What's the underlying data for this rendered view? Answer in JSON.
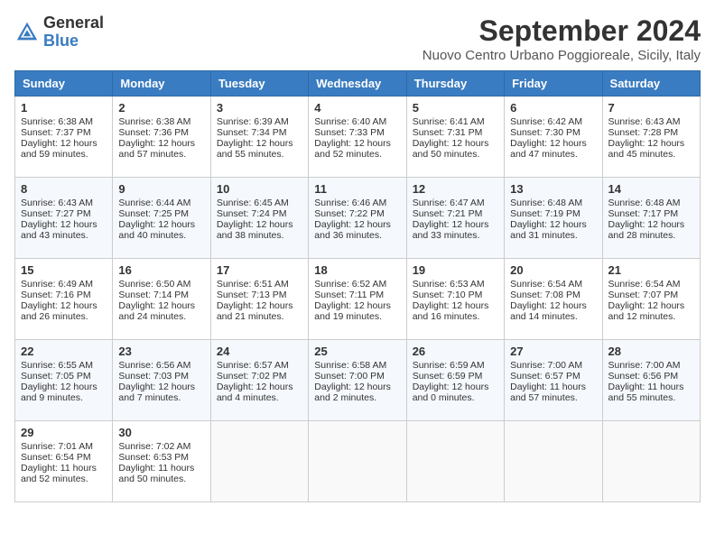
{
  "header": {
    "logo_general": "General",
    "logo_blue": "Blue",
    "title": "September 2024",
    "subtitle": "Nuovo Centro Urbano Poggioreale, Sicily, Italy"
  },
  "columns": [
    "Sunday",
    "Monday",
    "Tuesday",
    "Wednesday",
    "Thursday",
    "Friday",
    "Saturday"
  ],
  "weeks": [
    [
      {
        "day": "1",
        "sunrise": "6:38 AM",
        "sunset": "7:37 PM",
        "daylight": "12 hours and 59 minutes."
      },
      {
        "day": "2",
        "sunrise": "6:38 AM",
        "sunset": "7:36 PM",
        "daylight": "12 hours and 57 minutes."
      },
      {
        "day": "3",
        "sunrise": "6:39 AM",
        "sunset": "7:34 PM",
        "daylight": "12 hours and 55 minutes."
      },
      {
        "day": "4",
        "sunrise": "6:40 AM",
        "sunset": "7:33 PM",
        "daylight": "12 hours and 52 minutes."
      },
      {
        "day": "5",
        "sunrise": "6:41 AM",
        "sunset": "7:31 PM",
        "daylight": "12 hours and 50 minutes."
      },
      {
        "day": "6",
        "sunrise": "6:42 AM",
        "sunset": "7:30 PM",
        "daylight": "12 hours and 47 minutes."
      },
      {
        "day": "7",
        "sunrise": "6:43 AM",
        "sunset": "7:28 PM",
        "daylight": "12 hours and 45 minutes."
      }
    ],
    [
      {
        "day": "8",
        "sunrise": "6:43 AM",
        "sunset": "7:27 PM",
        "daylight": "12 hours and 43 minutes."
      },
      {
        "day": "9",
        "sunrise": "6:44 AM",
        "sunset": "7:25 PM",
        "daylight": "12 hours and 40 minutes."
      },
      {
        "day": "10",
        "sunrise": "6:45 AM",
        "sunset": "7:24 PM",
        "daylight": "12 hours and 38 minutes."
      },
      {
        "day": "11",
        "sunrise": "6:46 AM",
        "sunset": "7:22 PM",
        "daylight": "12 hours and 36 minutes."
      },
      {
        "day": "12",
        "sunrise": "6:47 AM",
        "sunset": "7:21 PM",
        "daylight": "12 hours and 33 minutes."
      },
      {
        "day": "13",
        "sunrise": "6:48 AM",
        "sunset": "7:19 PM",
        "daylight": "12 hours and 31 minutes."
      },
      {
        "day": "14",
        "sunrise": "6:48 AM",
        "sunset": "7:17 PM",
        "daylight": "12 hours and 28 minutes."
      }
    ],
    [
      {
        "day": "15",
        "sunrise": "6:49 AM",
        "sunset": "7:16 PM",
        "daylight": "12 hours and 26 minutes."
      },
      {
        "day": "16",
        "sunrise": "6:50 AM",
        "sunset": "7:14 PM",
        "daylight": "12 hours and 24 minutes."
      },
      {
        "day": "17",
        "sunrise": "6:51 AM",
        "sunset": "7:13 PM",
        "daylight": "12 hours and 21 minutes."
      },
      {
        "day": "18",
        "sunrise": "6:52 AM",
        "sunset": "7:11 PM",
        "daylight": "12 hours and 19 minutes."
      },
      {
        "day": "19",
        "sunrise": "6:53 AM",
        "sunset": "7:10 PM",
        "daylight": "12 hours and 16 minutes."
      },
      {
        "day": "20",
        "sunrise": "6:54 AM",
        "sunset": "7:08 PM",
        "daylight": "12 hours and 14 minutes."
      },
      {
        "day": "21",
        "sunrise": "6:54 AM",
        "sunset": "7:07 PM",
        "daylight": "12 hours and 12 minutes."
      }
    ],
    [
      {
        "day": "22",
        "sunrise": "6:55 AM",
        "sunset": "7:05 PM",
        "daylight": "12 hours and 9 minutes."
      },
      {
        "day": "23",
        "sunrise": "6:56 AM",
        "sunset": "7:03 PM",
        "daylight": "12 hours and 7 minutes."
      },
      {
        "day": "24",
        "sunrise": "6:57 AM",
        "sunset": "7:02 PM",
        "daylight": "12 hours and 4 minutes."
      },
      {
        "day": "25",
        "sunrise": "6:58 AM",
        "sunset": "7:00 PM",
        "daylight": "12 hours and 2 minutes."
      },
      {
        "day": "26",
        "sunrise": "6:59 AM",
        "sunset": "6:59 PM",
        "daylight": "12 hours and 0 minutes."
      },
      {
        "day": "27",
        "sunrise": "7:00 AM",
        "sunset": "6:57 PM",
        "daylight": "11 hours and 57 minutes."
      },
      {
        "day": "28",
        "sunrise": "7:00 AM",
        "sunset": "6:56 PM",
        "daylight": "11 hours and 55 minutes."
      }
    ],
    [
      {
        "day": "29",
        "sunrise": "7:01 AM",
        "sunset": "6:54 PM",
        "daylight": "11 hours and 52 minutes."
      },
      {
        "day": "30",
        "sunrise": "7:02 AM",
        "sunset": "6:53 PM",
        "daylight": "11 hours and 50 minutes."
      },
      null,
      null,
      null,
      null,
      null
    ]
  ]
}
